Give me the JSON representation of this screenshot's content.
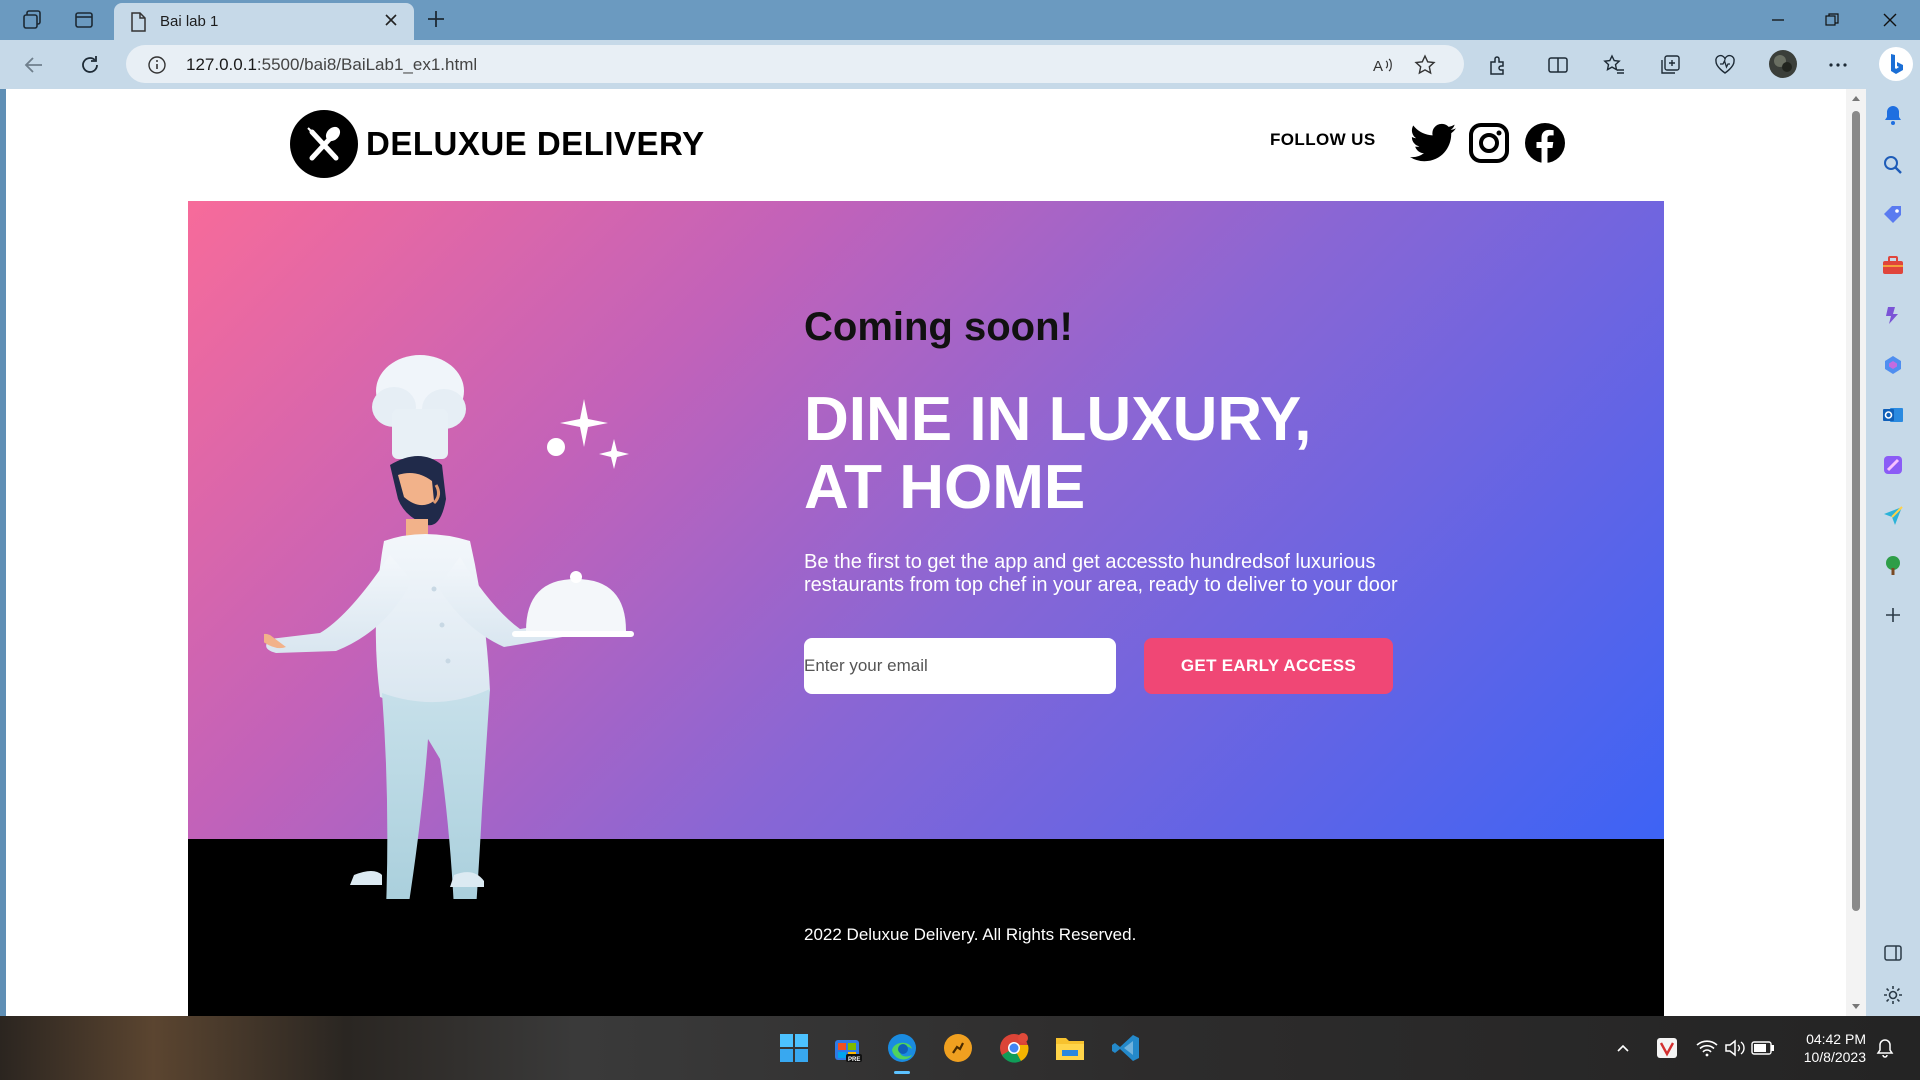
{
  "browser": {
    "tab_title": "Bai lab 1",
    "url_host": "127.0.0.1",
    "url_path": ":5500/bai8/BaiLab1_ex1.html"
  },
  "site": {
    "brand": "DELUXUE DELIVERY",
    "follow_label": "FOLLOW US",
    "social": [
      "twitter-icon",
      "instagram-icon",
      "facebook-icon"
    ]
  },
  "hero": {
    "coming_soon": "Coming soon!",
    "headline_line1": "DINE IN LUXURY,",
    "headline_line2": "AT HOME",
    "description": "Be the first to get the app and get accessto hundredsof luxurious restaurants from top chef in your area, ready to deliver to your door",
    "email_placeholder": "Enter your email",
    "cta_label": "GET EARLY ACCESS"
  },
  "footer": {
    "copyright": "2022 Deluxue Delivery. All Rights Reserved."
  },
  "taskbar": {
    "time": "04:42 PM",
    "date": "10/8/2023"
  },
  "colors": {
    "gradient_start": "#f76b9a",
    "gradient_end": "#3d63f5",
    "cta": "#f04775"
  }
}
